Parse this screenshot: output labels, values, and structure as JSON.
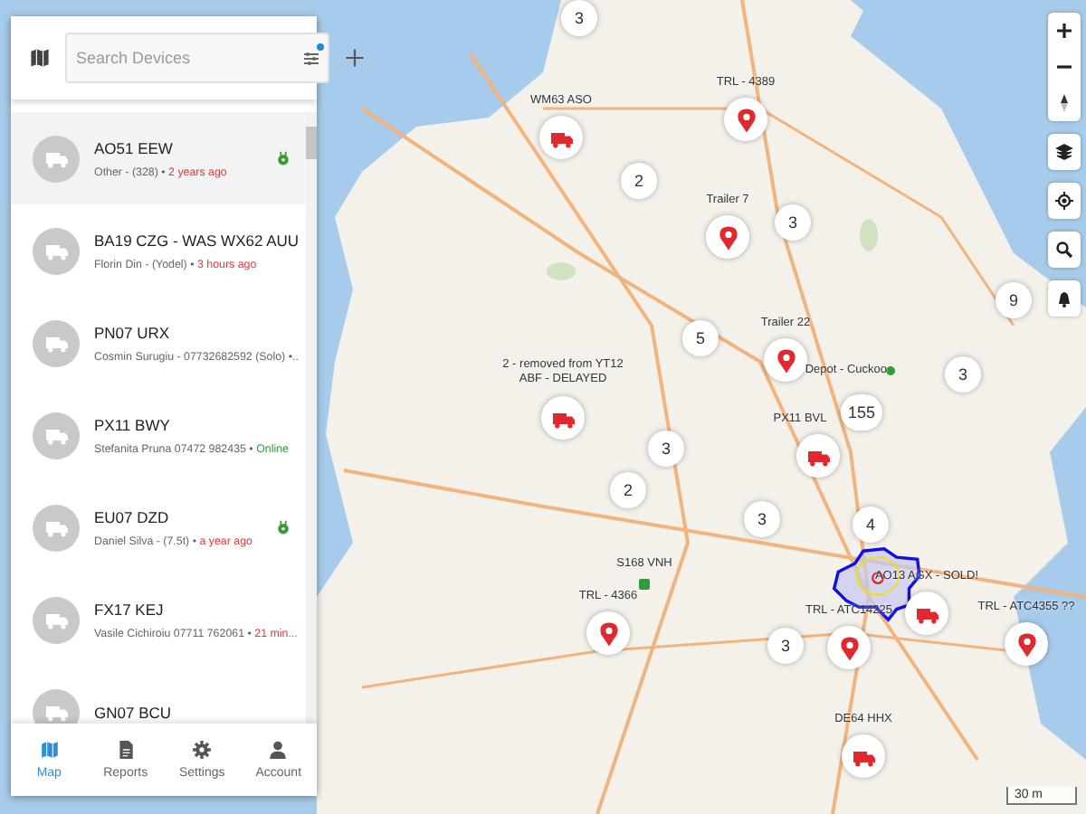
{
  "sidebar": {
    "search": {
      "placeholder": "Search Devices"
    },
    "filter_badge": true,
    "devices": [
      {
        "title": "AO51 EEW",
        "detail": "Other - (328) •",
        "status": "2 years ago",
        "color": "#e53935",
        "selected": true,
        "plugged": true
      },
      {
        "title": "BA19 CZG - WAS WX62 AUU",
        "detail": "Florin Din - (Yodel) •",
        "status": "3 hours ago",
        "color": "#e53935",
        "selected": false,
        "plugged": false
      },
      {
        "title": "PN07 URX",
        "detail": "Cosmin Surugiu - 07732682592 (Solo) •..",
        "selected": false,
        "plugged": false
      },
      {
        "title": "PX11 BWY",
        "detail": "Stefanita Pruna 07472 982435 •",
        "status": "Online",
        "color": "#2e9b3f",
        "selected": false,
        "plugged": false
      },
      {
        "title": "EU07 DZD",
        "detail": "Daniel Silva - (7.5t) •",
        "status": "a year ago",
        "color": "#e53935",
        "selected": false,
        "plugged": true
      },
      {
        "title": "FX17 KEJ",
        "detail": "Vasile Cichiroiu 07711 762061 •",
        "status": "21 min...",
        "color": "#e53935",
        "selected": false,
        "plugged": false
      },
      {
        "title": "GN07 BCU",
        "selected": false,
        "plugged": false
      }
    ],
    "nav": [
      {
        "label": "Map",
        "kind": "map",
        "selected": true
      },
      {
        "label": "Reports",
        "kind": "reports",
        "selected": false
      },
      {
        "label": "Settings",
        "kind": "settings",
        "selected": false
      },
      {
        "label": "Account",
        "kind": "account",
        "selected": false
      }
    ]
  },
  "map": {
    "markers": [
      {
        "kind": "cluster",
        "count": "3"
      },
      {
        "kind": "truck",
        "label": "WM63 ASO"
      },
      {
        "kind": "pin",
        "label": "TRL - 4389"
      },
      {
        "kind": "cluster",
        "count": "2"
      },
      {
        "kind": "pin",
        "label": "Trailer 7"
      },
      {
        "kind": "cluster",
        "count": "3"
      },
      {
        "kind": "cluster",
        "count": "9"
      },
      {
        "kind": "pin",
        "label": "Trailer 22"
      },
      {
        "kind": "cluster",
        "count": "5"
      },
      {
        "kind": "truck",
        "label": "2 - removed from YT12 ABF - DELAYED"
      },
      {
        "kind": "depot",
        "label": "Depot - Cuckoo"
      },
      {
        "kind": "cluster",
        "count": "155"
      },
      {
        "kind": "cluster",
        "count": "3"
      },
      {
        "kind": "truck",
        "label": "PX11 BVL"
      },
      {
        "kind": "cluster",
        "count": "3"
      },
      {
        "kind": "cluster",
        "count": "2"
      },
      {
        "kind": "cluster",
        "count": "3"
      },
      {
        "kind": "cluster",
        "count": "4"
      },
      {
        "kind": "dot",
        "label": "S168 VNH"
      },
      {
        "kind": "pin",
        "label": "TRL - 4366"
      },
      {
        "kind": "truck",
        "label": "AO13 AGX - SOLD!"
      },
      {
        "kind": "pin",
        "label": "TRL - ATC14225"
      },
      {
        "kind": "cluster",
        "count": "3"
      },
      {
        "kind": "pin",
        "label": "TRL - ATC4355 ??"
      },
      {
        "kind": "truck",
        "label": "DE64 HHX"
      }
    ],
    "scale": "30 m"
  }
}
